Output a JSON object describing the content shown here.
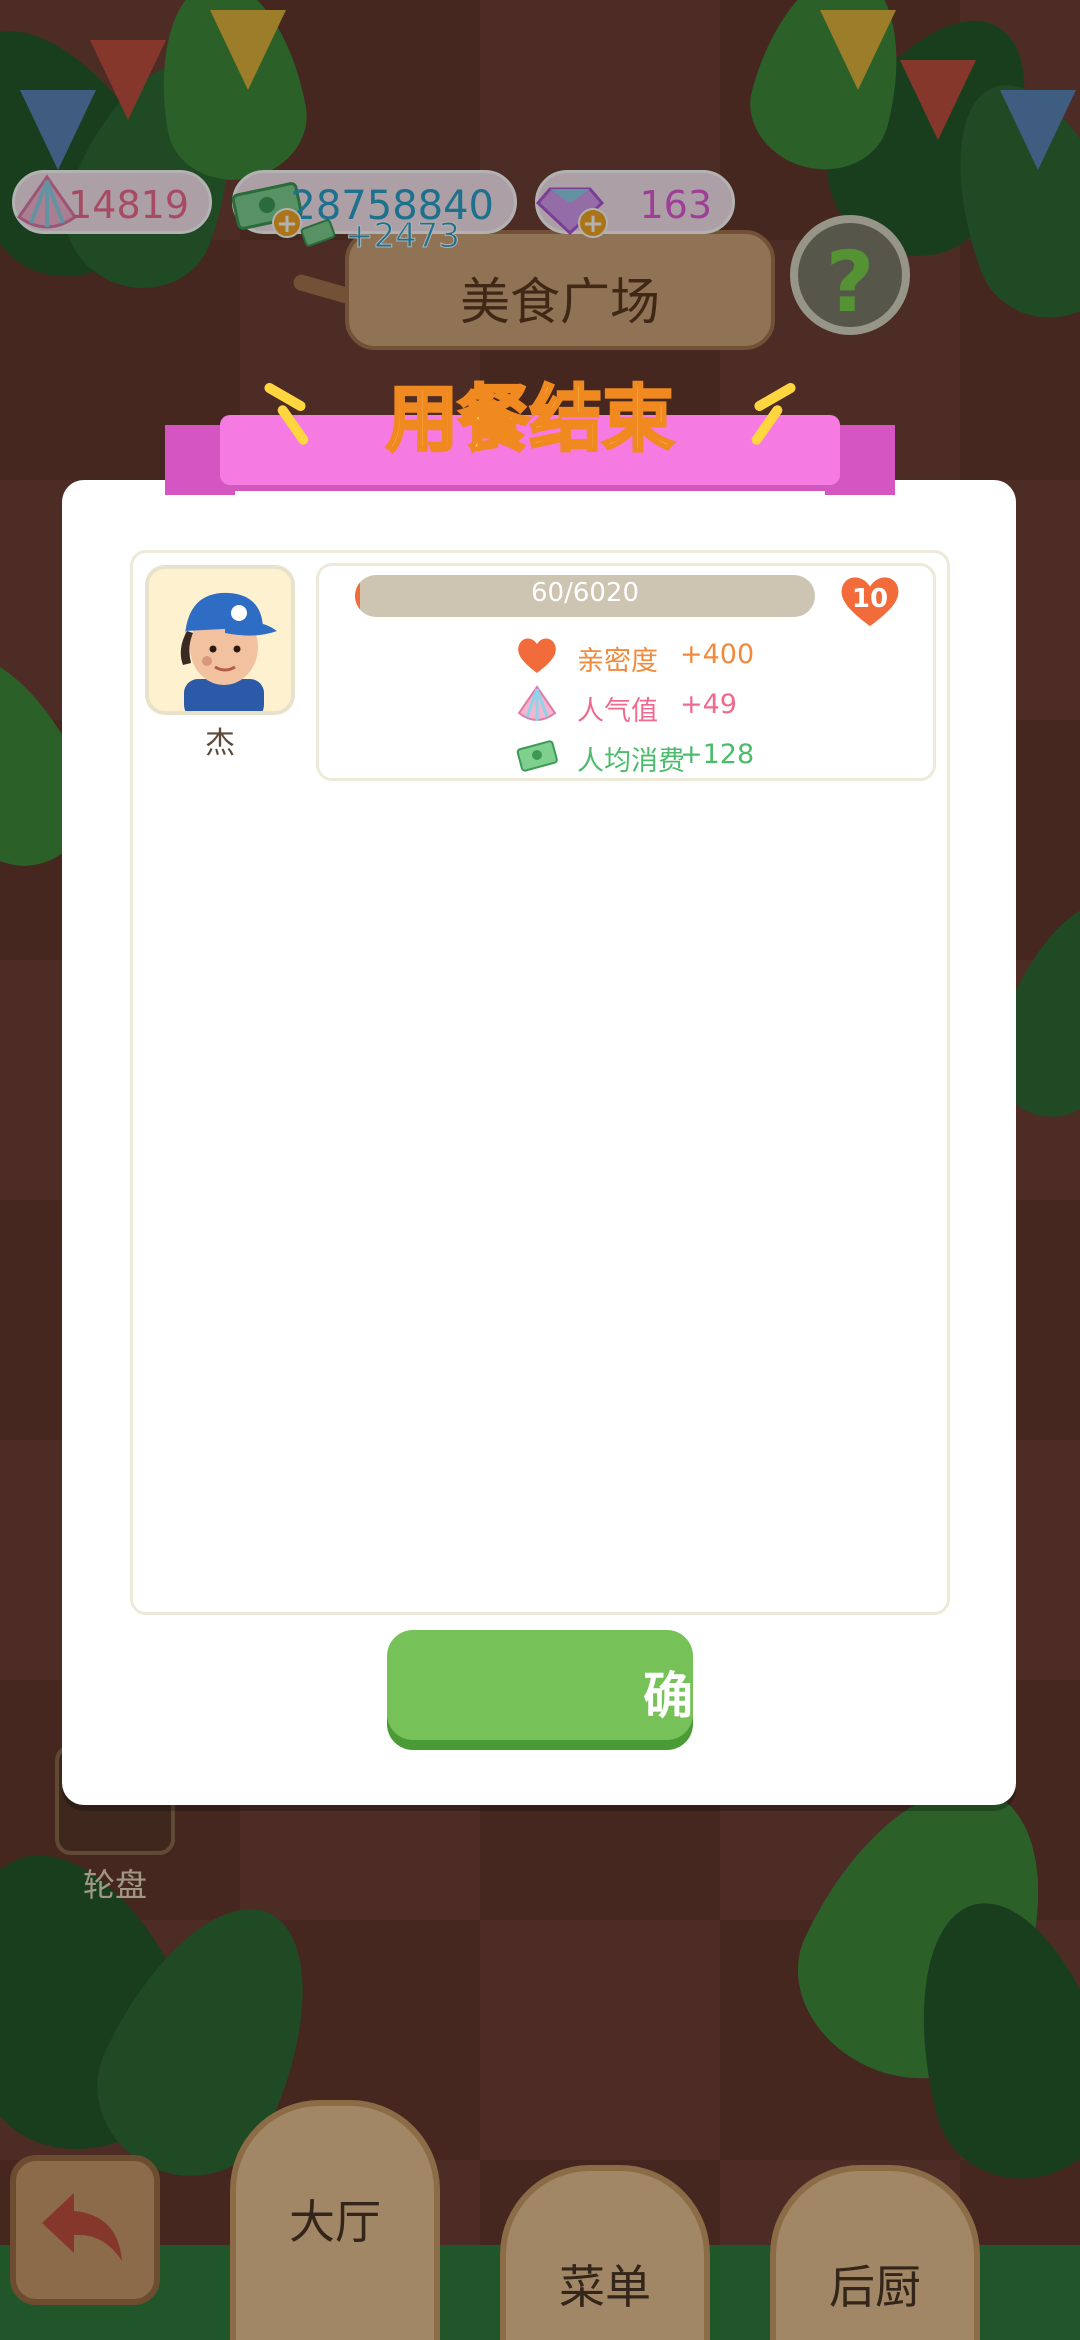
{
  "currencies": {
    "shells": {
      "value": "14819",
      "icon": "shell-icon",
      "color": "#f06a8e"
    },
    "cash": {
      "value": "28758840",
      "gain": "+2473",
      "icon": "cash-icon",
      "color": "#2aa3c9"
    },
    "gems": {
      "value": "163",
      "icon": "gem-icon",
      "color": "#e35bd9"
    }
  },
  "header": {
    "sign_title": "美食广场",
    "help_label": "?"
  },
  "dialog": {
    "title": "用餐结束",
    "customer": {
      "name": "杰",
      "progress_text": "60/6020",
      "progress_fraction": 0.01,
      "level": "10",
      "stats": [
        {
          "icon": "heart-icon",
          "label": "亲密度",
          "amount": "+400",
          "color": "#f08a3c"
        },
        {
          "icon": "shell-icon",
          "label": "人气值",
          "amount": "+49",
          "color": "#f06a8e"
        },
        {
          "icon": "cash-icon",
          "label": "人均消费",
          "amount": "+128",
          "color": "#4cbc6c"
        }
      ]
    },
    "confirm_label": "确定"
  },
  "side": {
    "wheel_label": "轮盘"
  },
  "nav": {
    "tabs": [
      "大厅",
      "菜单",
      "后厨"
    ]
  }
}
